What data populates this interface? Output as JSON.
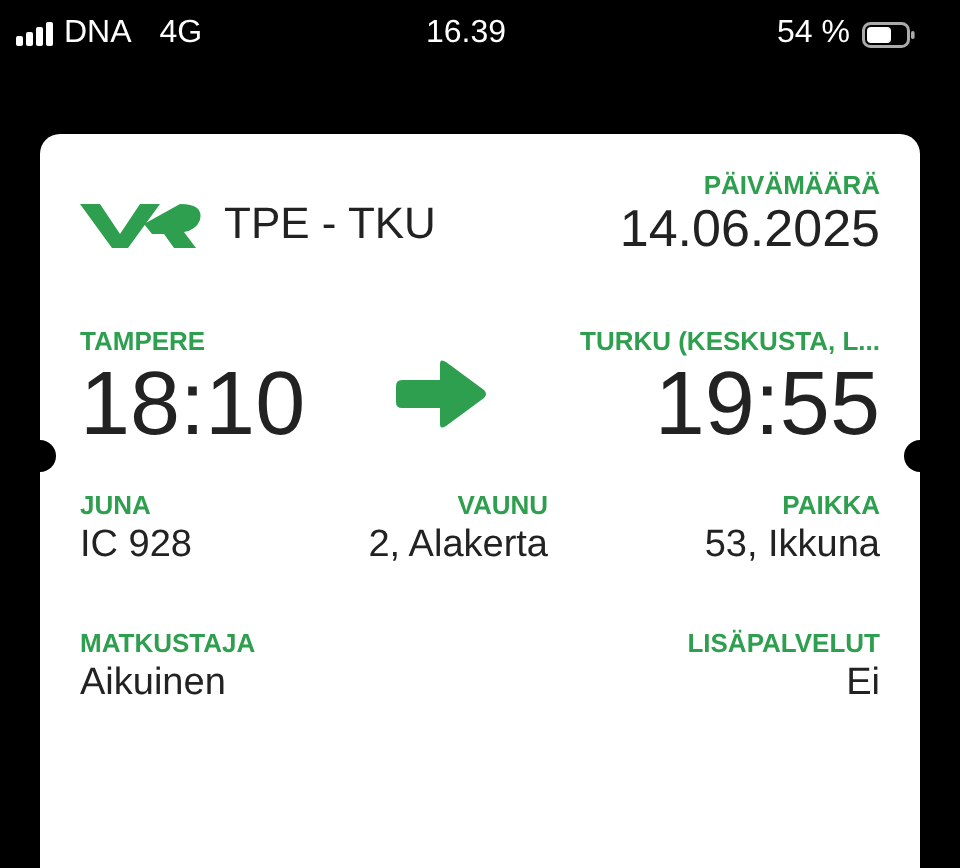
{
  "status_bar": {
    "carrier": "DNA",
    "network": "4G",
    "time": "16.39",
    "battery": "54 %"
  },
  "ticket": {
    "route": "TPE - TKU",
    "date_label": "PÄIVÄMÄÄRÄ",
    "date": "14.06.2025",
    "departure": {
      "station": "TAMPERE",
      "time": "18:10"
    },
    "arrival": {
      "station": "TURKU (KESKUSTA, L...",
      "time": "19:55"
    },
    "detail_rows": [
      [
        {
          "label": "JUNA",
          "value": "IC 928"
        },
        {
          "label": "VAUNU",
          "value": "2, Alakerta"
        },
        {
          "label": "PAIKKA",
          "value": "53, Ikkuna"
        }
      ],
      [
        {
          "label": "MATKUSTAJA",
          "value": "Aikuinen"
        },
        {
          "label": "LISÄPALVELUT",
          "value": "Ei"
        }
      ]
    ]
  }
}
